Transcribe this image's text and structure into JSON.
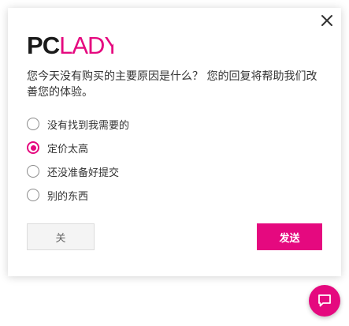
{
  "brand": {
    "logo_text": "PCLADY",
    "accent_color": "#e5097f"
  },
  "survey": {
    "question": "您今天没有购买的主要原因是什么？ 您的回复将帮助我们改善您的体验。",
    "options": [
      {
        "label": "没有找到我需要的",
        "checked": false
      },
      {
        "label": "定价太高",
        "checked": true
      },
      {
        "label": "还没准备好提交",
        "checked": false
      },
      {
        "label": "别的东西",
        "checked": false
      }
    ]
  },
  "buttons": {
    "close_label": "关",
    "send_label": "发送"
  },
  "icons": {
    "dialog_close": "close-icon",
    "chat": "chat-bubble-icon"
  }
}
